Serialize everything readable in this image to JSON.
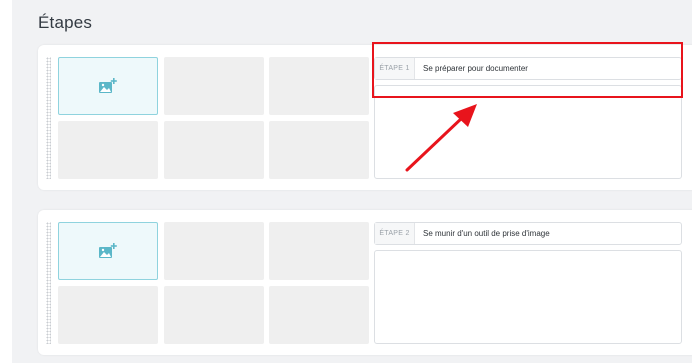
{
  "page": {
    "title": "Étapes"
  },
  "steps": [
    {
      "number_label": "ÉTAPE 1",
      "title": "Se préparer pour documenter"
    },
    {
      "number_label": "ÉTAPE 2",
      "title": "Se munir d'un outil de prise d'image"
    }
  ],
  "icons": {
    "add_image": "add-image-icon",
    "drag": "drag-handle-icon"
  },
  "annotation": {
    "highlight_color": "#e8141c"
  },
  "colors": {
    "accent": "#5bb7c8",
    "add_tile_bg": "#eef9fb",
    "thumb_bg": "#efefef",
    "panel_bg": "#f1f2f4"
  }
}
